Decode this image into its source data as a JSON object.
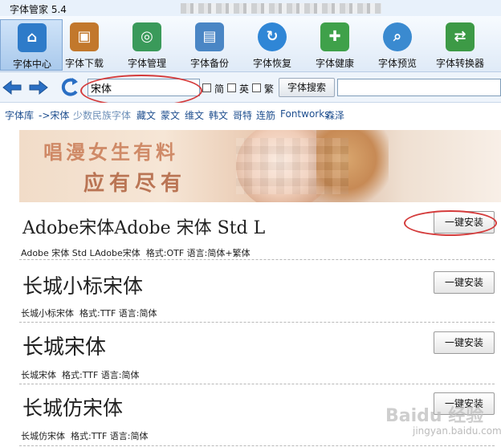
{
  "window": {
    "title": "字体管家 5.4"
  },
  "toolbar": {
    "items": [
      {
        "label": "字体中心",
        "icon": "home-icon",
        "color": "#2e7bc9",
        "active": true
      },
      {
        "label": "字体下载",
        "icon": "download-box-icon",
        "color": "#c2782c"
      },
      {
        "label": "字体管理",
        "icon": "document-manage-icon",
        "color": "#3a9a5a"
      },
      {
        "label": "字体备份",
        "icon": "document-backup-icon",
        "color": "#4a86c5"
      },
      {
        "label": "字体恢复",
        "icon": "globe-refresh-icon",
        "color": "#2f86d6"
      },
      {
        "label": "字体健康",
        "icon": "first-aid-kit-icon",
        "color": "#3fa14a"
      },
      {
        "label": "字体预览",
        "icon": "magnifier-icon",
        "color": "#3a8ad0"
      },
      {
        "label": "字体转换器",
        "icon": "convert-icon",
        "color": "#3d9a46"
      }
    ]
  },
  "search": {
    "value": "宋体",
    "options": [
      {
        "label": "简"
      },
      {
        "label": "英"
      },
      {
        "label": "繁"
      }
    ],
    "button_label": "字体搜索"
  },
  "categories": {
    "items": [
      "字体库",
      "->宋体",
      "少数民族字体",
      "藏文",
      "蒙文",
      "维文",
      "韩文",
      "哥特",
      "连筋",
      "Fontworks",
      "森泽"
    ]
  },
  "banner": {
    "line1": "唱漫女生有料",
    "line2": "应有尽有"
  },
  "fonts": {
    "install_label": "一键安装",
    "items": [
      {
        "sample": "Adobe宋体Adobe 宋体 Std L",
        "name": "Adobe 宋体  Std LAdobe宋体",
        "format": "格式:OTF",
        "lang": "语言:简体+繁体"
      },
      {
        "sample": "长城小标宋体",
        "name": "长城小标宋体",
        "format": "格式:TTF",
        "lang": "语言:简体"
      },
      {
        "sample": "长城宋体",
        "name": "长城宋体",
        "format": "格式:TTF",
        "lang": "语言:简体"
      },
      {
        "sample": "长城仿宋体",
        "name": "长城仿宋体",
        "format": "格式:TTF",
        "lang": "语言:简体"
      }
    ]
  },
  "watermark": {
    "text": "Baidu 经验",
    "sub": "jingyan.baidu.com"
  }
}
